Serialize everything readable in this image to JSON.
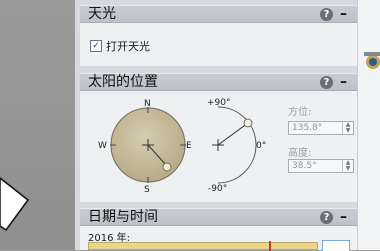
{
  "daylight": {
    "title": "天光",
    "help_label": "?",
    "collapse_label": "–",
    "checkbox_label": "打开天光",
    "checkbox_checked": true,
    "checkbox_mark": "✓"
  },
  "sun_position": {
    "title": "太阳的位置",
    "help_label": "?",
    "collapse_label": "–",
    "compass": {
      "north": "N",
      "south": "S",
      "east": "E",
      "west": "W"
    },
    "elevation_dial": {
      "top": "+90°",
      "zero": "0°",
      "bottom": "-90°"
    },
    "azimuth_label": "方位:",
    "azimuth_value": "135.8°",
    "altitude_label": "高度:",
    "altitude_value": "38.5°"
  },
  "date_time": {
    "title": "日期与时间",
    "help_label": "?",
    "collapse_label": "–",
    "year_label": "2016 年:"
  },
  "colors": {
    "accent": "#c0392b",
    "timeline": "#e9d58c"
  }
}
